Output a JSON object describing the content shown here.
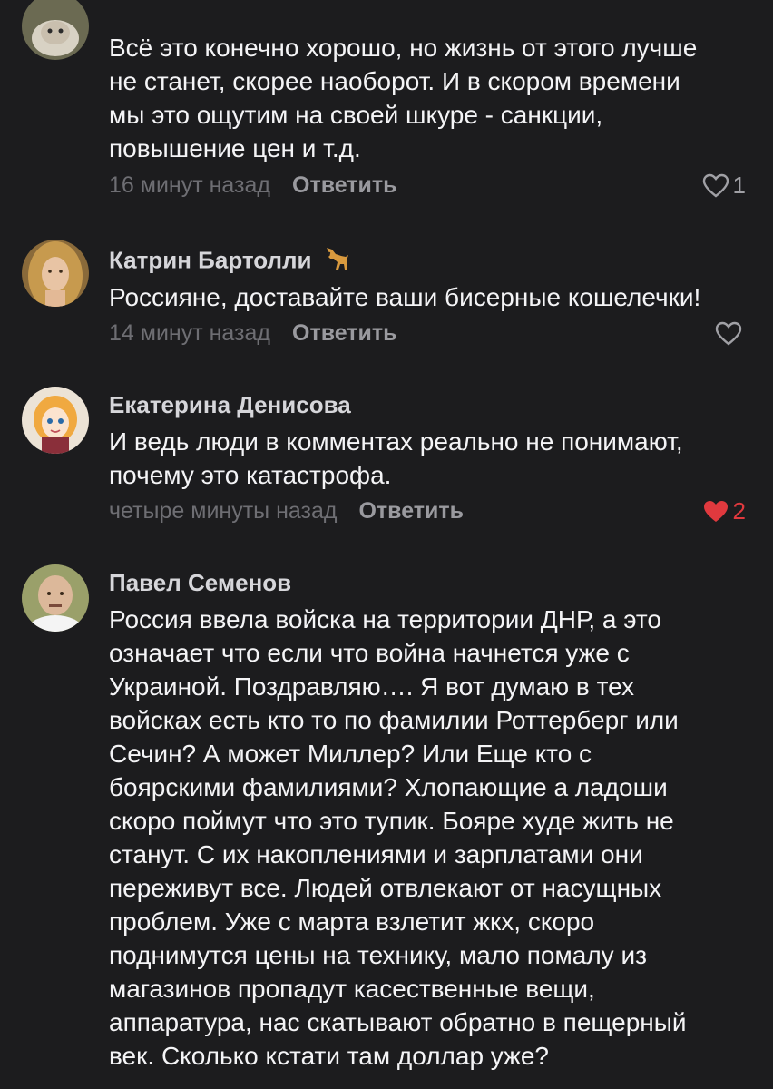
{
  "comments": [
    {
      "author": "",
      "text": "Всё это конечно хорошо, но жизнь от этого лучше\nне станет, скорее наоборот. И в скором времени\nмы это ощутим  на своей шкуре - санкции,\nповышение цен и т.д.",
      "time": "16 минут назад",
      "reply": "Ответить",
      "likes": "1",
      "liked": false,
      "avatar_icon": "cat-avatar"
    },
    {
      "author": "Катрин Бартолли",
      "text": "Россияне, доставайте ваши бисерные кошелечки!",
      "time": "14 минут назад",
      "reply": "Ответить",
      "likes": "",
      "liked": false,
      "avatar_icon": "woman-avatar",
      "author_badge": "dog-emoji"
    },
    {
      "author": "Екатерина Денисова",
      "text": "И ведь люди в комментах реально не понимают,\nпочему это катастрофа.",
      "time": "четыре минуты назад",
      "reply": "Ответить",
      "likes": "2",
      "liked": true,
      "avatar_icon": "cartoon-girl-avatar"
    },
    {
      "author": "Павел Семенов",
      "text": "Россия ввела войска на территории ДНР, а это\nозначает что если что война начнется уже с\nУкраиной. Поздравляю…. Я вот думаю в тех\nвойсках есть кто то по фамилии Роттерберг или\nСечин? А может Миллер? Или Еще кто с\nбоярскими фамилиями? Хлопающие а ладоши\nскоро поймут что это тупик. Бояре худе жить не\nстанут. С их накоплениями и зарплатами они\nпереживут все. Людей отвлекают от насущных\nпроблем. Уже с марта взлетит жкх, скоро\nподнимутся цены на технику, мало помалу из\nмагазинов пропадут касественные вещи,\nаппаратура, нас скатывают обратно в пещерный\nвек. Сколько кстати там доллар уже?",
      "time": "",
      "reply": "",
      "likes": "",
      "liked": false,
      "avatar_icon": "bald-man-avatar"
    }
  ],
  "colors": {
    "background": "#1c1c1e",
    "like_active": "#e0393e",
    "muted": "#6e6e73"
  }
}
